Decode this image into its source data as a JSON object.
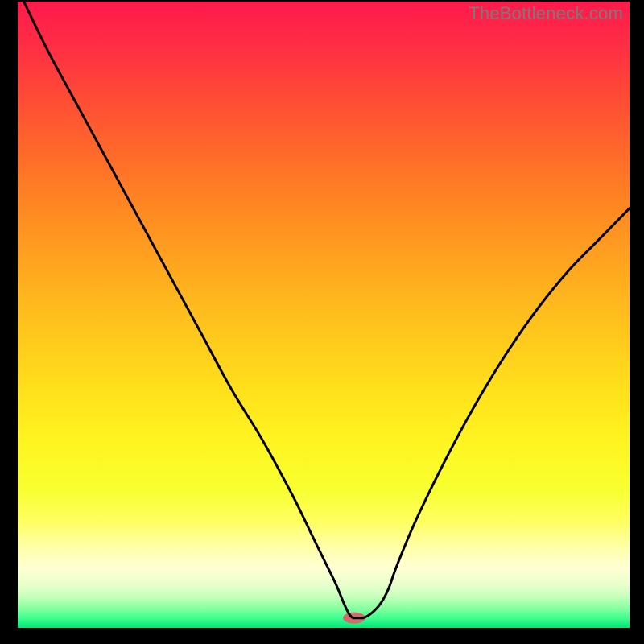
{
  "watermark": "TheBottleneck.com",
  "gradient": {
    "stops": [
      {
        "offset": 0.0,
        "color": "#ff1a4c"
      },
      {
        "offset": 0.06,
        "color": "#ff2a46"
      },
      {
        "offset": 0.14,
        "color": "#ff4638"
      },
      {
        "offset": 0.22,
        "color": "#ff622c"
      },
      {
        "offset": 0.3,
        "color": "#ff7e24"
      },
      {
        "offset": 0.38,
        "color": "#ff9820"
      },
      {
        "offset": 0.46,
        "color": "#ffb21e"
      },
      {
        "offset": 0.54,
        "color": "#ffca1c"
      },
      {
        "offset": 0.62,
        "color": "#ffe01c"
      },
      {
        "offset": 0.7,
        "color": "#fff420"
      },
      {
        "offset": 0.78,
        "color": "#f8ff30"
      },
      {
        "offset": 0.83,
        "color": "#ffff60"
      },
      {
        "offset": 0.87,
        "color": "#ffffa8"
      },
      {
        "offset": 0.905,
        "color": "#ffffd4"
      },
      {
        "offset": 0.93,
        "color": "#eaffcc"
      },
      {
        "offset": 0.95,
        "color": "#c6ffbc"
      },
      {
        "offset": 0.968,
        "color": "#8affa0"
      },
      {
        "offset": 0.984,
        "color": "#40ff90"
      },
      {
        "offset": 1.0,
        "color": "#00e878"
      }
    ]
  },
  "chart_data": {
    "type": "line",
    "title": "",
    "xlabel": "",
    "ylabel": "",
    "xlim": [
      0,
      100
    ],
    "ylim": [
      0,
      100
    ],
    "series": [
      {
        "name": "bottleneck-curve",
        "x": [
          1,
          5,
          10,
          15,
          20,
          25,
          30,
          35,
          40,
          45,
          48,
          50,
          52,
          53.5,
          54.5,
          55.5,
          57,
          59,
          60.5,
          62,
          65,
          70,
          75,
          80,
          85,
          90,
          95,
          100
        ],
        "y": [
          100,
          92,
          83,
          74,
          65,
          56,
          47,
          38,
          30,
          21,
          15,
          11,
          7,
          3.5,
          1.8,
          1.6,
          1.8,
          3.5,
          6,
          10,
          17,
          27,
          36,
          44,
          51,
          57,
          62,
          67
        ]
      }
    ],
    "marker": {
      "x": 55,
      "y": 1.6,
      "color": "#d46a6a",
      "rx": 14,
      "ry": 7
    }
  }
}
